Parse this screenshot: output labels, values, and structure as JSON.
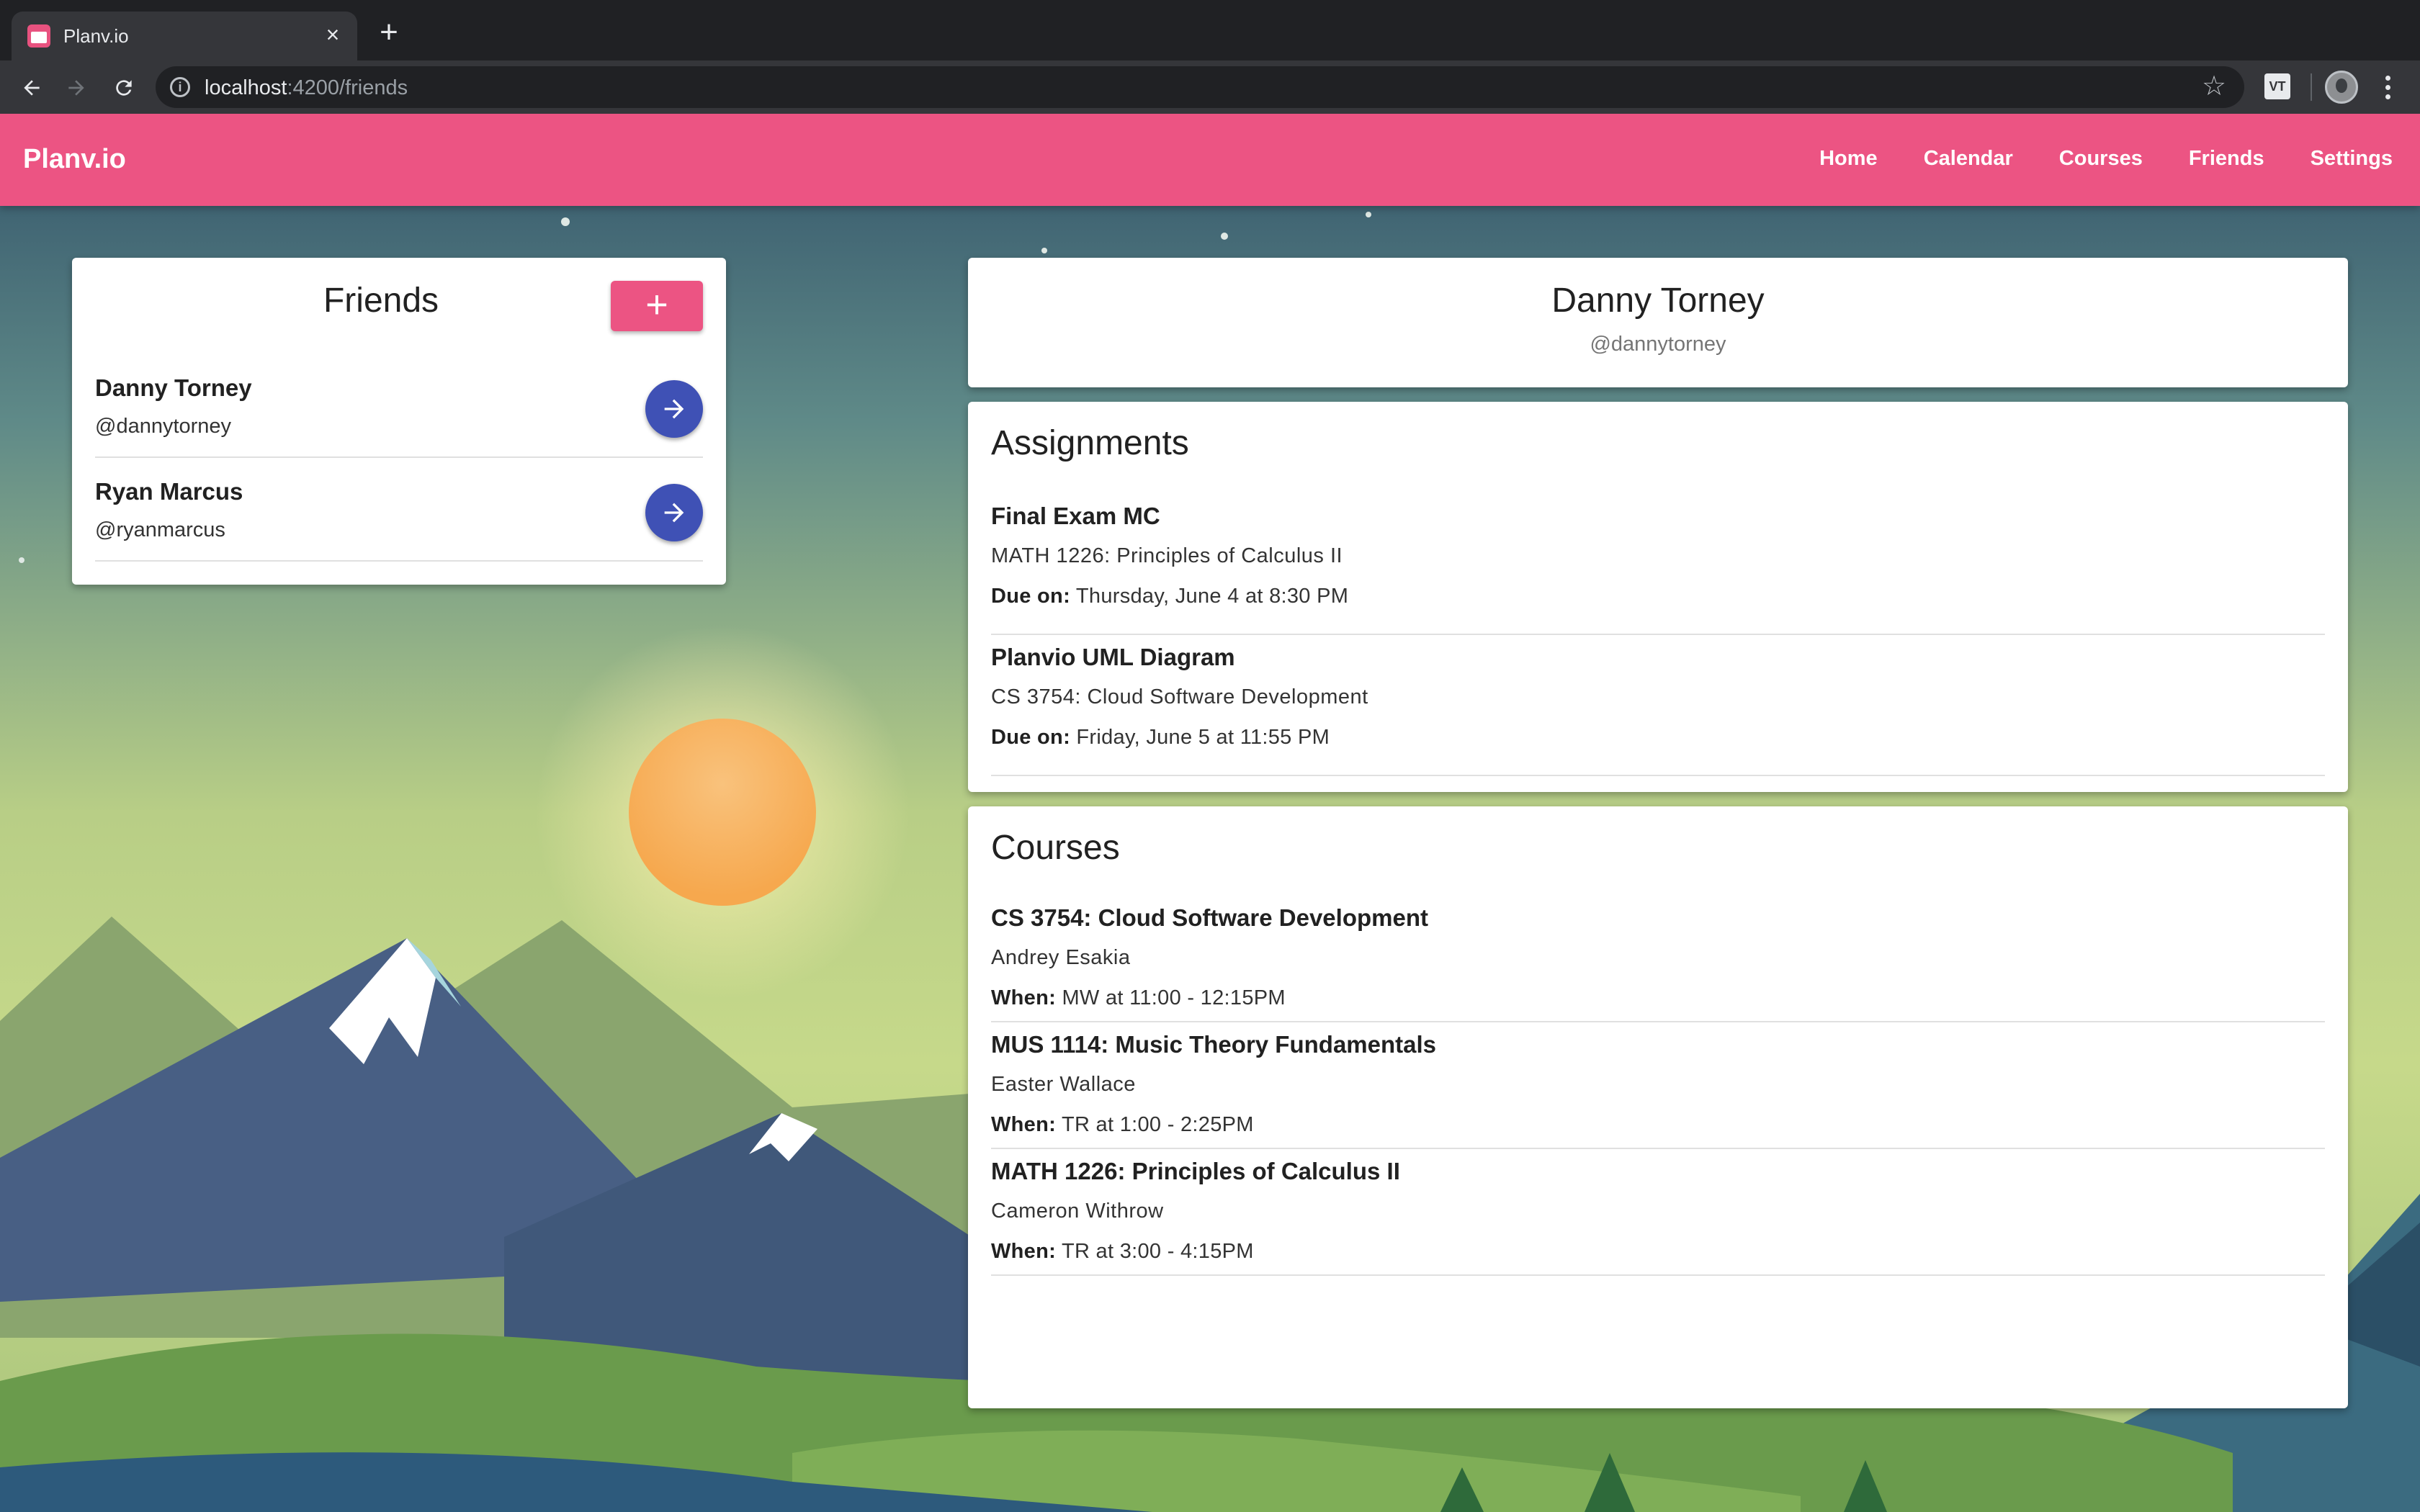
{
  "browser": {
    "tab_title": "Planv.io",
    "url_host": "localhost",
    "url_path": ":4200/friends",
    "ext_label": "VT"
  },
  "app": {
    "brand": "Planv.io",
    "nav": [
      "Home",
      "Calendar",
      "Courses",
      "Friends",
      "Settings"
    ]
  },
  "friends_panel": {
    "title": "Friends",
    "add_label": "+",
    "friends": [
      {
        "name": "Danny Torney",
        "handle": "@dannytorney"
      },
      {
        "name": "Ryan Marcus",
        "handle": "@ryanmarcus"
      }
    ]
  },
  "profile": {
    "name": "Danny Torney",
    "handle": "@dannytorney"
  },
  "assignments": {
    "title": "Assignments",
    "due_label": "Due on:",
    "items": [
      {
        "title": "Final Exam MC",
        "course": "MATH 1226: Principles of Calculus II",
        "due": "Thursday, June 4 at 8:30 PM"
      },
      {
        "title": "Planvio UML Diagram",
        "course": "CS 3754: Cloud Software Development",
        "due": "Friday, June 5 at 11:55 PM"
      }
    ]
  },
  "courses": {
    "title": "Courses",
    "when_label": "When:",
    "items": [
      {
        "title": "CS 3754: Cloud Software Development",
        "instructor": "Andrey Esakia",
        "when": "MW at 11:00 - 12:15PM"
      },
      {
        "title": "MUS 1114: Music Theory Fundamentals",
        "instructor": "Easter Wallace",
        "when": "TR at 1:00 - 2:25PM"
      },
      {
        "title": "MATH 1226: Principles of Calculus II",
        "instructor": "Cameron Withrow",
        "when": "TR at 3:00 - 4:15PM"
      }
    ]
  },
  "colors": {
    "accent": "#ec5483",
    "fab": "#3f51b5"
  }
}
